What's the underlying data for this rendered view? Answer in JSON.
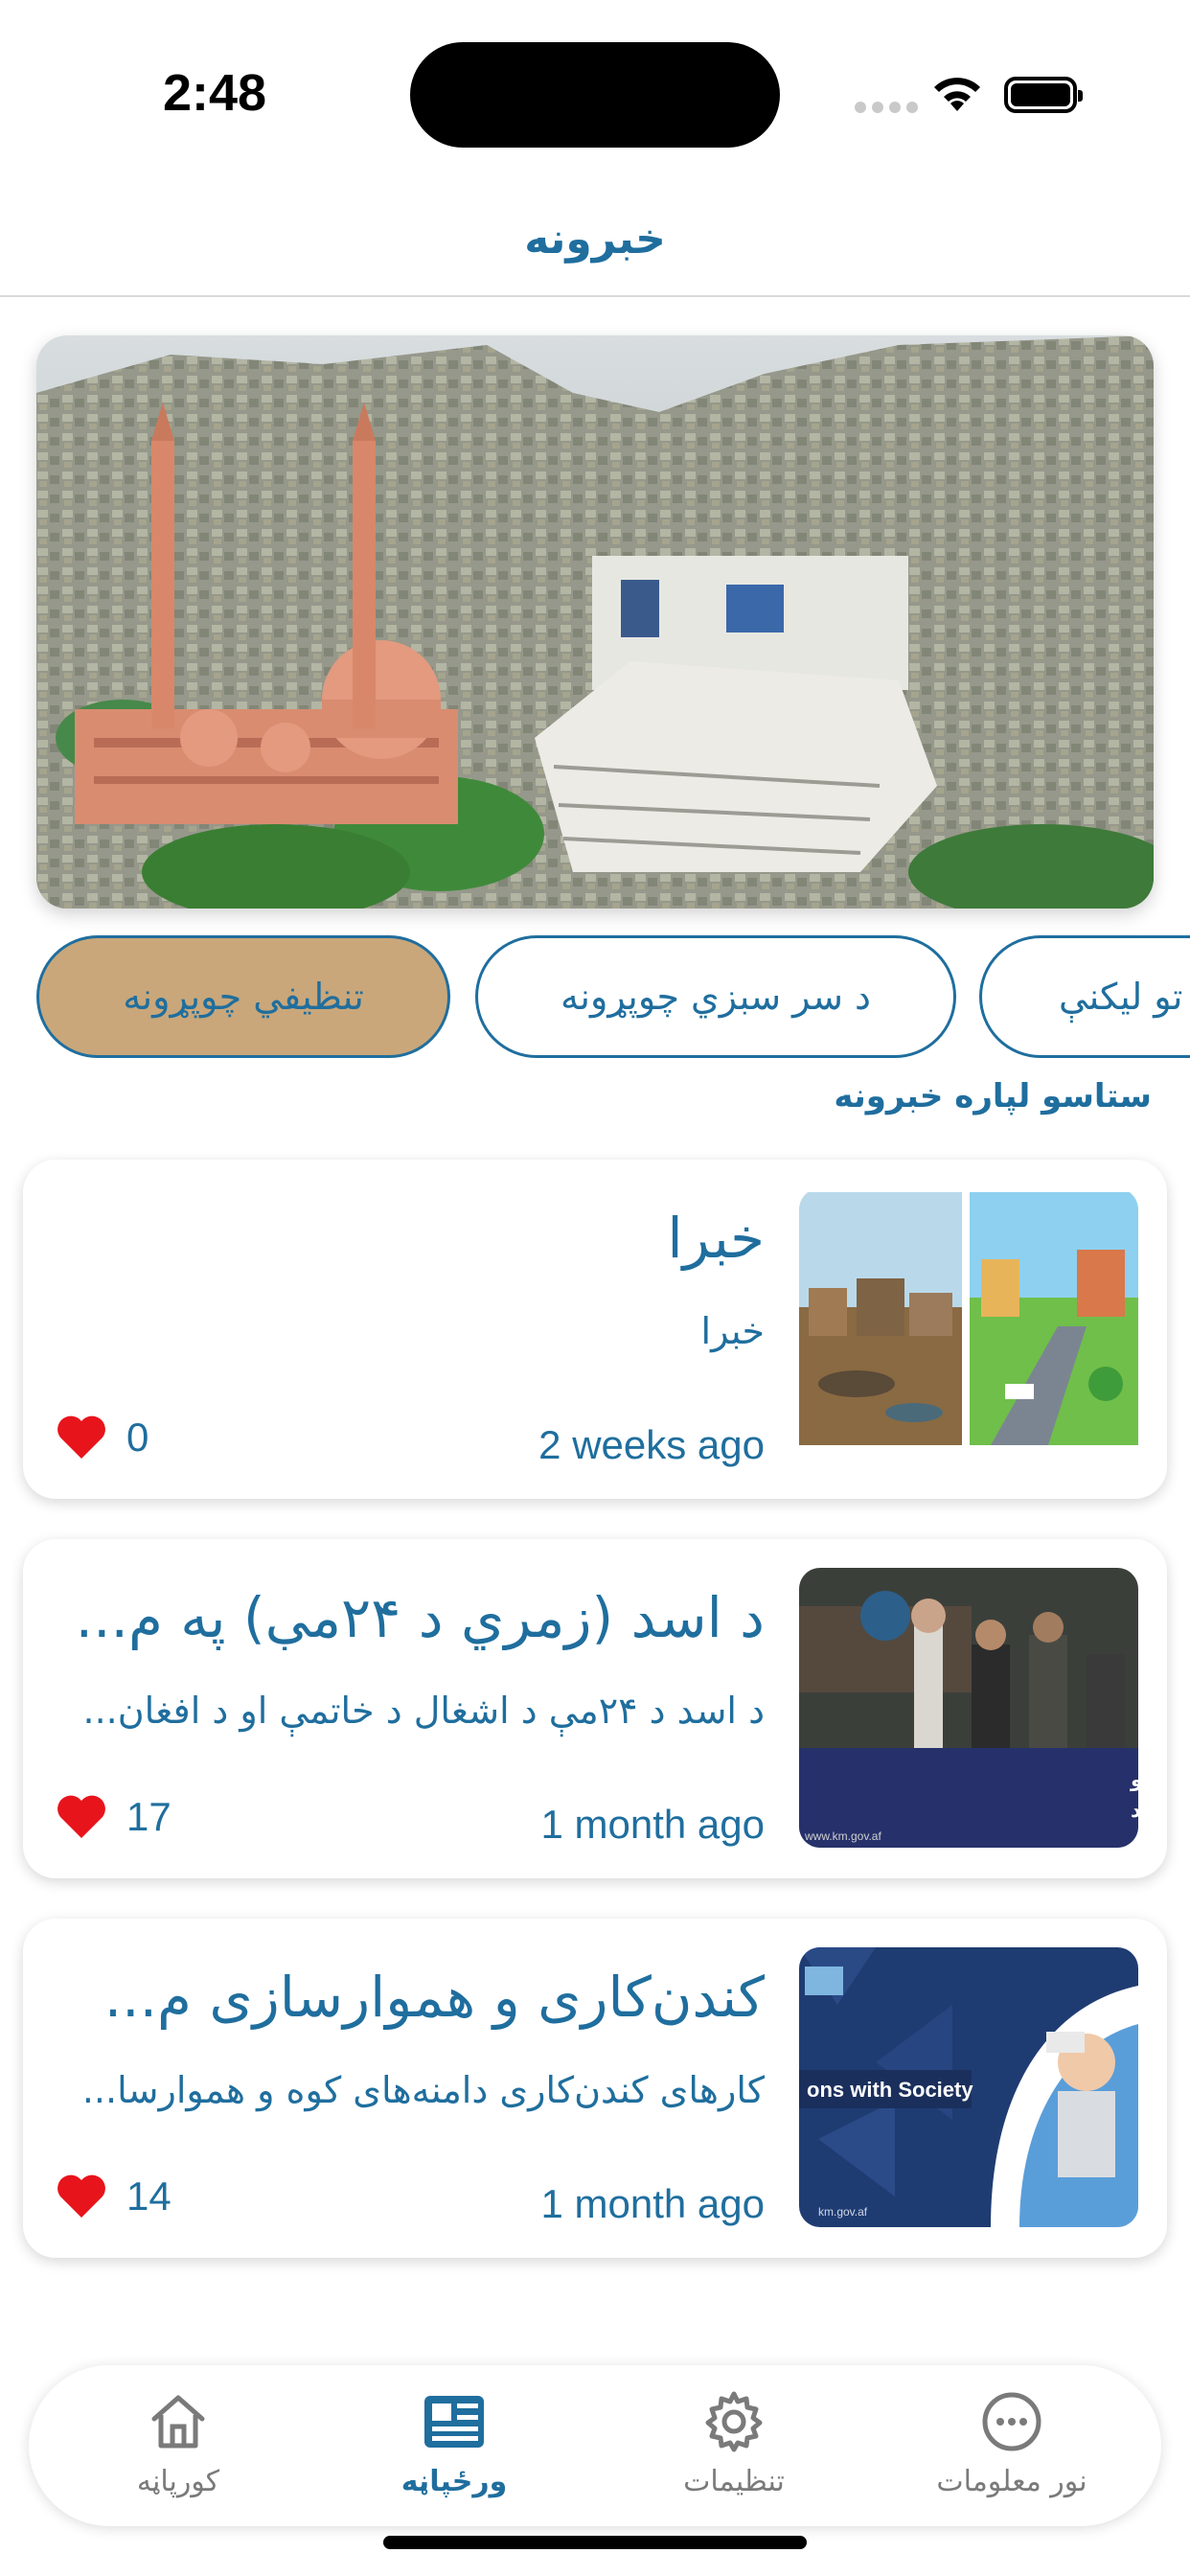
{
  "status_bar": {
    "time": "2:48"
  },
  "header": {
    "title": "خبرونه"
  },
  "chips": [
    {
      "label": "تنظيفي چوپړونه",
      "active": true
    },
    {
      "label": "د سر سبزي چوپړونه",
      "active": false
    },
    {
      "label": "تو ليکنې",
      "active": false
    }
  ],
  "section_label": "ستاسو لپاره خبرونه",
  "cards": [
    {
      "title": "خبرا",
      "description": "خبرا",
      "time": "2 weeks ago",
      "likes": "0"
    },
    {
      "title": "د اسد (زمري د ۲۴مې) په م...",
      "description": "د اسد د ۲۴مې د اشغال د خاتمې او د افغان...",
      "time": "1 month ago",
      "likes": "17"
    },
    {
      "title": "کندن‌کاری و هموارسازی م...",
      "description": "کارهای کندن‌کاری دامنه‌های کوه و هموارسا...",
      "time": "1 month ago",
      "likes": "14"
    }
  ],
  "thumb_text": {
    "card2_line1": "آگاهی‌دهی برای کاهش آلودگی هوا و",
    "card2_line2": "حفظ‌الصحه در ناحیه یازدهم برگزار شد",
    "card2_url": "www.km.gov.af",
    "card3_banner": "ons with Society",
    "card3_url": "km.gov.af"
  },
  "tabs": [
    {
      "label": "کورپاڼه",
      "icon": "home-icon",
      "active": false
    },
    {
      "label": "ورځپاڼه",
      "icon": "newspaper-icon",
      "active": true
    },
    {
      "label": "تنظیمات",
      "icon": "gear-icon",
      "active": false
    },
    {
      "label": "نور معلومات",
      "icon": "more-icon",
      "active": false
    }
  ],
  "colors": {
    "accent": "#1f6e9e",
    "chip_active": "#c9a77a",
    "heart": "#e8141c",
    "inactive_tab": "#7a7a7a"
  }
}
